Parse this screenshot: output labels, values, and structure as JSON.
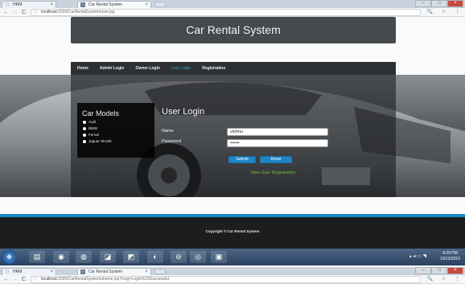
{
  "browser_top": {
    "tabs": [
      {
        "label": "HRM",
        "active": false
      },
      {
        "label": "Car Rental System",
        "active": true
      }
    ],
    "url_host": "localhost",
    "url_rest": ":2020/CarRentalSystem/user.jsp"
  },
  "header": {
    "title": "Car Rental System"
  },
  "nav": {
    "items": [
      "Home",
      "Admin Login",
      "Owner Login",
      "User Login",
      "Registration"
    ],
    "active": "User Login"
  },
  "car_models": {
    "title": "Car Models",
    "items": [
      "Audi",
      "BMW",
      "Ferrari",
      "Jaguar XK150"
    ]
  },
  "login": {
    "title": "User Login",
    "name_label": "Name",
    "password_label": "Password",
    "name_value": "vishnu",
    "password_value": "••••••",
    "submit_label": "Submit",
    "reset_label": "Reset",
    "register_link": "New User Registration"
  },
  "footer": {
    "copyright": "Copyright © Car Rental System"
  },
  "taskbar": {
    "time": "4:29 PM",
    "date": "10/13/2016"
  },
  "browser_bottom": {
    "tabs": [
      {
        "label": "HRM",
        "active": false
      },
      {
        "label": "Car Rental System",
        "active": true
      }
    ],
    "url_host": "localhost",
    "url_rest": ":2020/CarRentalSystem/uhome.jsp?msg=Login%20Successful"
  },
  "icons": {
    "back": "←",
    "forward": "→",
    "reload": "C",
    "info": "ⓘ",
    "zoom": "🔍",
    "star": "☆",
    "menu": "⋮",
    "close": "×",
    "minimize": "–",
    "maximize": "□"
  },
  "colors": {
    "accent": "#1a86c5",
    "link_green": "#6fc02c",
    "dark": "#2e3134"
  }
}
